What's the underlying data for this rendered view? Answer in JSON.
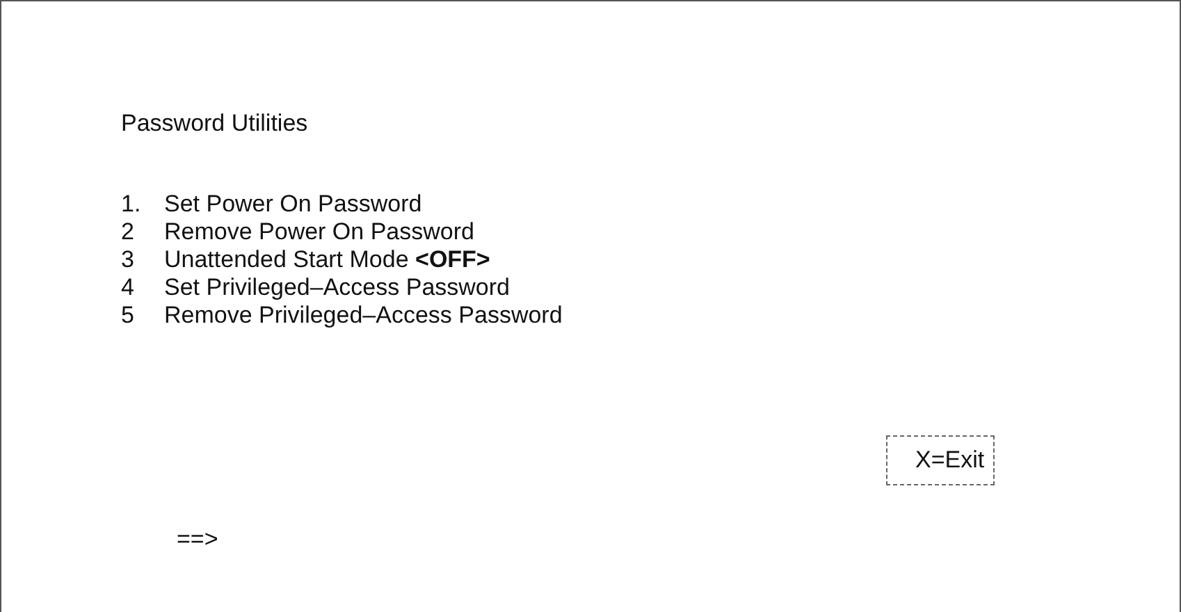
{
  "title": "Password Utilities",
  "menu_items": [
    {
      "number": "1.",
      "label": "Set Power On Password"
    },
    {
      "number": "2",
      "label": "Remove Power On Password"
    },
    {
      "number": "3",
      "label": "Unattended Start Mode **<OFF>**"
    },
    {
      "number": "4",
      "label": "Set Privileged–Access Password"
    },
    {
      "number": "5",
      "label": "Remove Privileged–Access Password"
    }
  ],
  "exit_key": "X=Exit",
  "prompt": "==>"
}
